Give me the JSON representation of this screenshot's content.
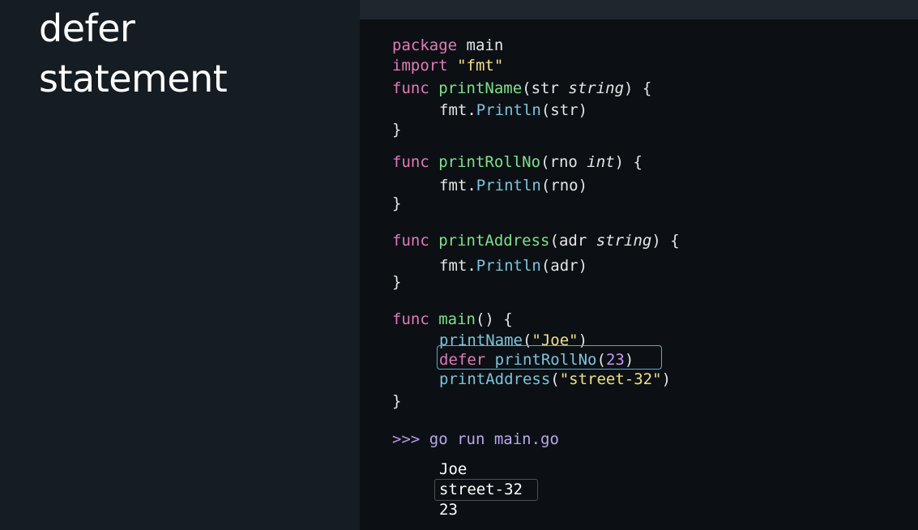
{
  "slide": {
    "title_line1": "defer",
    "title_line2": "statement"
  },
  "code": {
    "l1_kw": "package",
    "l1_rest": " main",
    "l2_kw": "import",
    "l2_str": "\"fmt\"",
    "f1_kw": "func",
    "f1_name": "printName",
    "f1_open": "(str ",
    "f1_type": "string",
    "f1_close": ") {",
    "f1_body_pkg": "fmt.",
    "f1_body_call": "Println",
    "f1_body_args": "(str)",
    "f1_end": "}",
    "f2_kw": "func",
    "f2_name": "printRollNo",
    "f2_open": "(rno ",
    "f2_type": "int",
    "f2_close": ") {",
    "f2_body_pkg": "fmt.",
    "f2_body_call": "Println",
    "f2_body_args": "(rno)",
    "f2_end": "}",
    "f3_kw": "func",
    "f3_name": "printAddress",
    "f3_open": "(adr ",
    "f3_type": "string",
    "f3_close": ") {",
    "f3_body_pkg": "fmt.",
    "f3_body_call": "Println",
    "f3_body_args": "(adr)",
    "f3_end": "}",
    "main_kw": "func",
    "main_name": "main",
    "main_open": "() {",
    "m1_call": "printName",
    "m1_paren_open": "(",
    "m1_str": "\"Joe\"",
    "m1_paren_close": ")",
    "m2_kw": "defer",
    "m2_call": "printRollNo",
    "m2_paren_open": "(",
    "m2_num": "23",
    "m2_paren_close": ")",
    "m3_call": "printAddress",
    "m3_paren_open": "(",
    "m3_str": "\"street-32\"",
    "m3_paren_close": ")",
    "main_end": "}"
  },
  "terminal": {
    "prompt": ">>>",
    "command": " go run main.go",
    "output": [
      "Joe",
      "street-32",
      "23"
    ]
  },
  "colors": {
    "keyword": "#e27bb8",
    "function_name": "#7ee08a",
    "call": "#7dc4dc",
    "string": "#f0e08a",
    "number": "#c497f0",
    "highlight_border": "#4fb0d0"
  }
}
